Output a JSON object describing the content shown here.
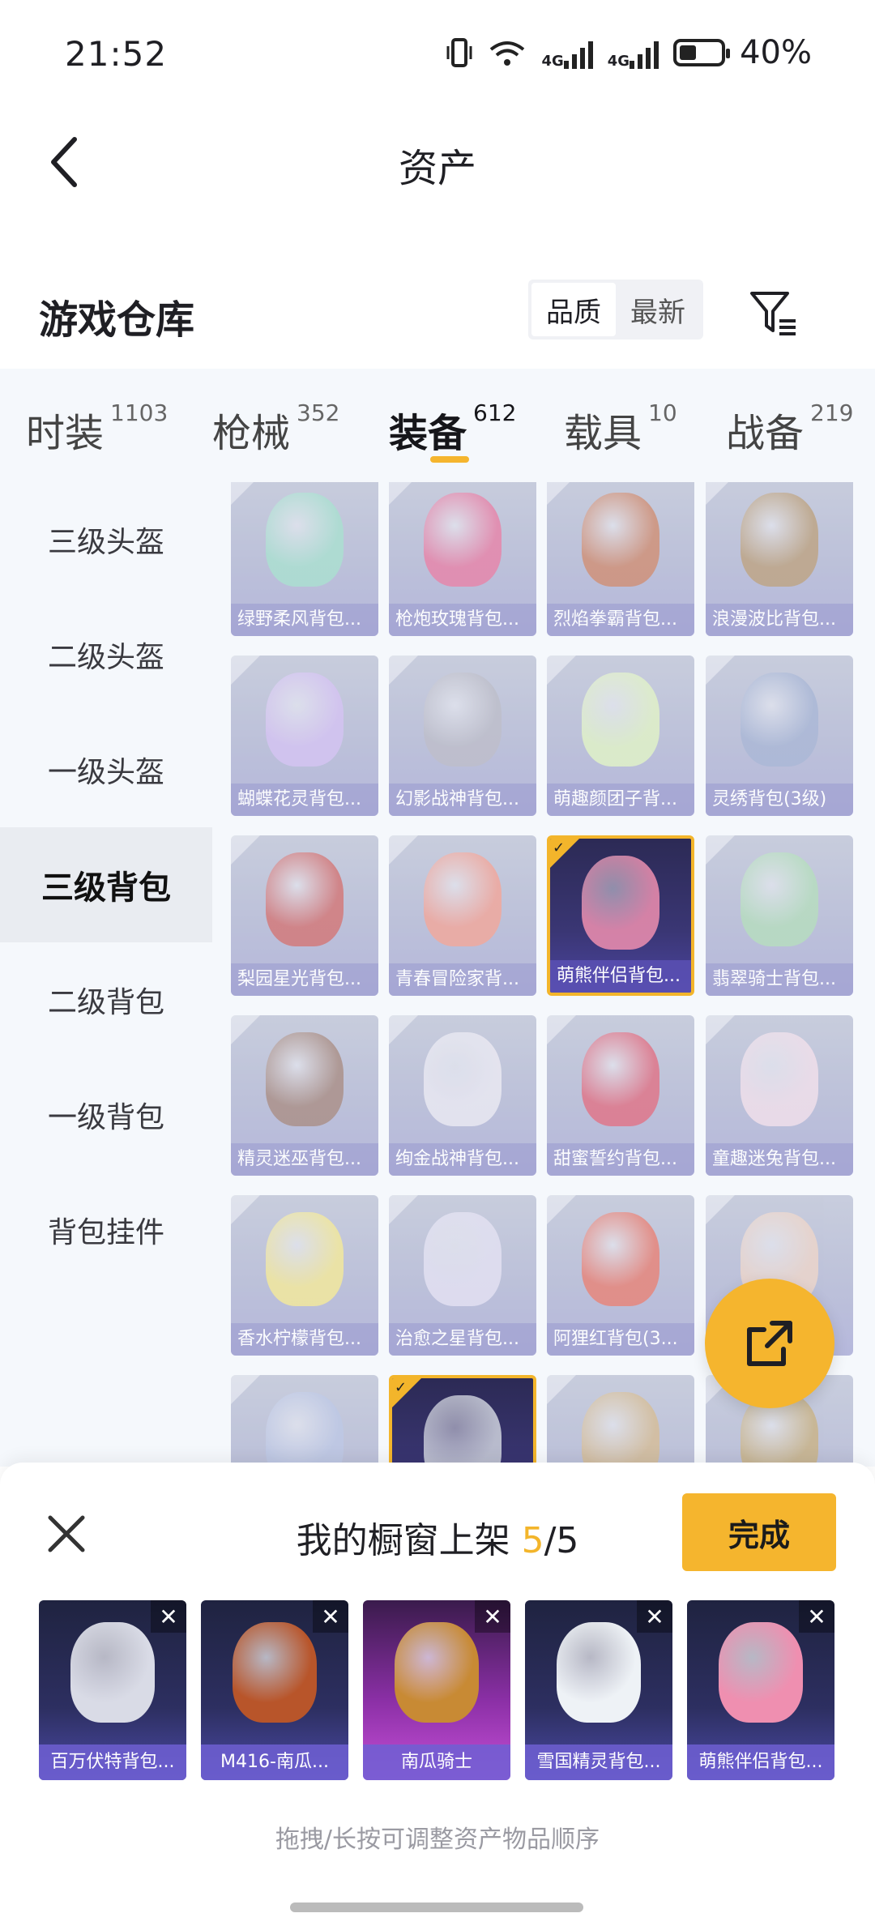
{
  "status": {
    "time": "21:52",
    "network_a": "4G",
    "network_b": "4G",
    "battery": "40%"
  },
  "header": {
    "title": "资产"
  },
  "warehouse": {
    "title": "游戏仓库",
    "sort_options": [
      "品质",
      "最新"
    ],
    "sort_active": "品质"
  },
  "tabs": [
    {
      "label": "时装",
      "count": "1103"
    },
    {
      "label": "枪械",
      "count": "352"
    },
    {
      "label": "装备",
      "count": "612"
    },
    {
      "label": "载具",
      "count": "10"
    },
    {
      "label": "战备",
      "count": "219"
    }
  ],
  "active_tab": "装备",
  "sidebar": {
    "items": [
      "三级头盔",
      "二级头盔",
      "一级头盔",
      "三级背包",
      "二级背包",
      "一级背包",
      "背包挂件"
    ],
    "active": "三级背包"
  },
  "grid": {
    "items": [
      {
        "name": "绿野柔风背包...",
        "color": "#8fd6c1",
        "selected": false
      },
      {
        "name": "枪炮玫瑰背包...",
        "color": "#e05c8c",
        "selected": false
      },
      {
        "name": "烈焰拳霸背包...",
        "color": "#c26b48",
        "selected": false
      },
      {
        "name": "浪漫波比背包...",
        "color": "#a9865a",
        "selected": false
      },
      {
        "name": "蝴蝶花灵背包...",
        "color": "#c8b0ee",
        "selected": false
      },
      {
        "name": "幻影战神背包...",
        "color": "#a9a9b8",
        "selected": false
      },
      {
        "name": "萌趣颜团子背...",
        "color": "#d9efb5",
        "selected": false
      },
      {
        "name": "灵绣背包(3级)",
        "color": "#8fa0c8",
        "selected": false
      },
      {
        "name": "梨园星光背包...",
        "color": "#c64a4a",
        "selected": false
      },
      {
        "name": "青春冒险家背...",
        "color": "#ef8a7a",
        "selected": false
      },
      {
        "name": "萌熊伴侣背包...",
        "color": "#ef8fb0",
        "selected": true
      },
      {
        "name": "翡翠骑士背包...",
        "color": "#9fd3a9",
        "selected": false
      },
      {
        "name": "精灵迷巫背包...",
        "color": "#8f6a5e",
        "selected": false
      },
      {
        "name": "绚金战神背包...",
        "color": "#e6e3ef",
        "selected": false
      },
      {
        "name": "甜蜜誓约背包...",
        "color": "#d8455e",
        "selected": false
      },
      {
        "name": "童趣迷兔背包...",
        "color": "#efd6e4",
        "selected": false
      },
      {
        "name": "香水柠檬背包...",
        "color": "#f1e27a",
        "selected": false
      },
      {
        "name": "治愈之星背包...",
        "color": "#dcd8ef",
        "selected": false
      },
      {
        "name": "阿狸红背包(3...",
        "color": "#e25b4b",
        "selected": false
      },
      {
        "name": "",
        "color": "#e8c8b8",
        "selected": false
      },
      {
        "name": "",
        "color": "#a9b6dc",
        "selected": false
      },
      {
        "name": "",
        "color": "#cfd3de",
        "selected": true
      },
      {
        "name": "",
        "color": "#c9a876",
        "selected": false
      },
      {
        "name": "",
        "color": "#b99b60",
        "selected": false
      }
    ]
  },
  "showcase": {
    "title_prefix": "我的橱窗上架",
    "count_current": "5",
    "count_total": "/5",
    "done_label": "完成",
    "items": [
      {
        "name": "百万伏特背包...",
        "color": "#d9dbe6"
      },
      {
        "name": "M416-南瓜...",
        "color": "#b8552a"
      },
      {
        "name": "南瓜骑士",
        "color": "#c88a34"
      },
      {
        "name": "雪国精灵背包...",
        "color": "#eef2f6"
      },
      {
        "name": "萌熊伴侣背包...",
        "color": "#ef8fb0"
      }
    ],
    "hint": "拖拽/长按可调整资产物品顺序"
  }
}
